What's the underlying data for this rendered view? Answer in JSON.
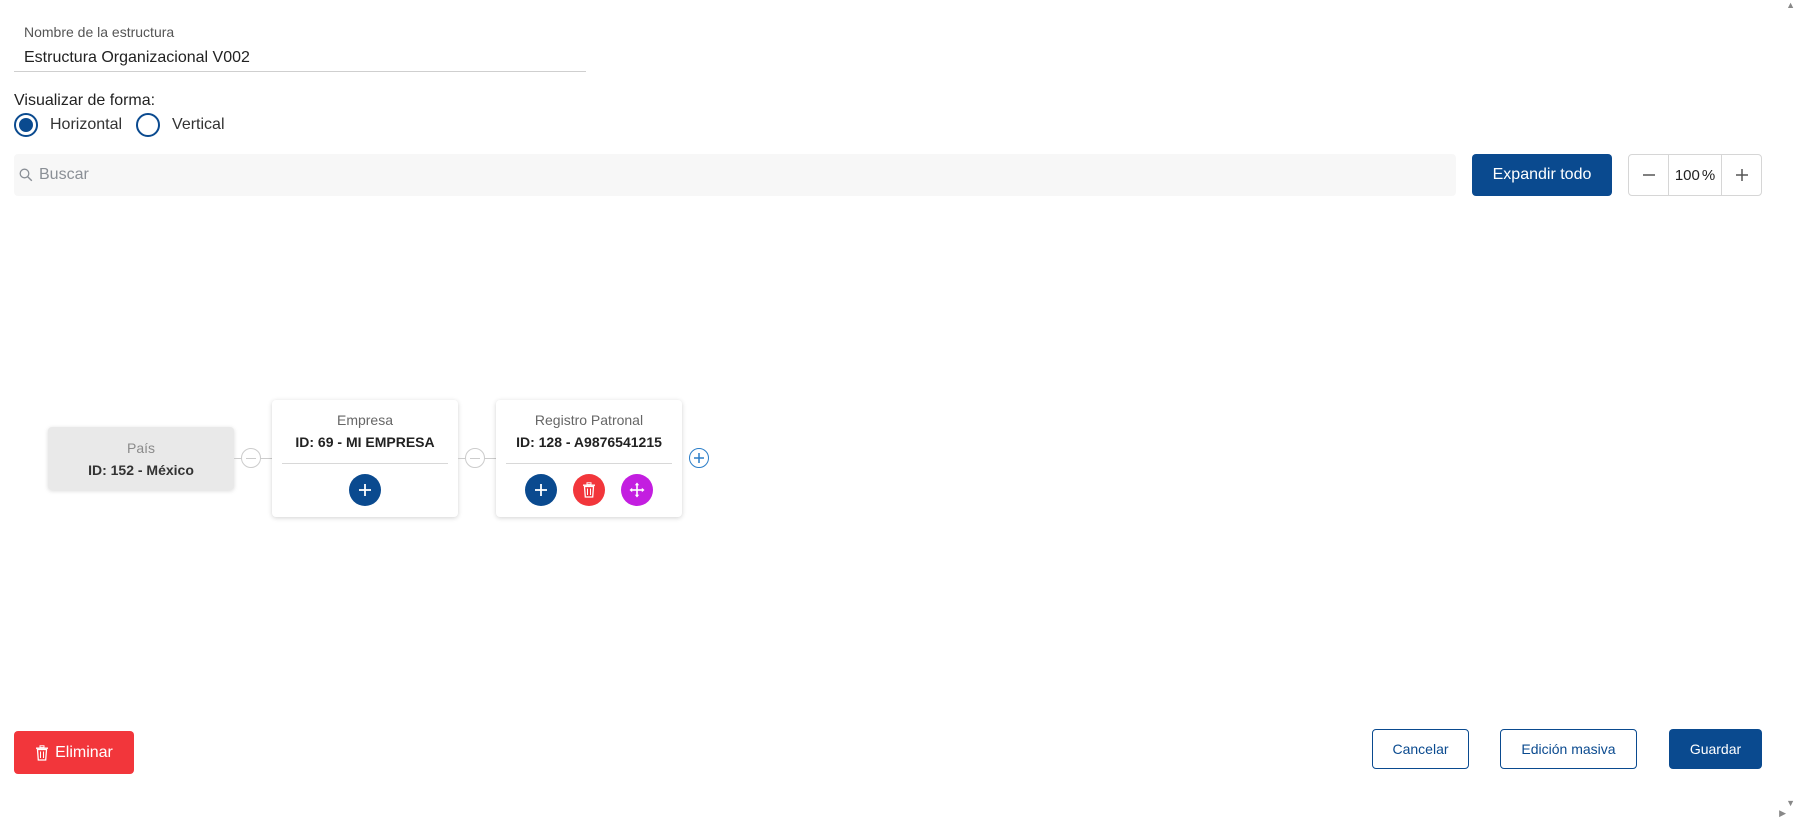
{
  "structure_name": {
    "label": "Nombre de la estructura",
    "value": "Estructura Organizacional V002"
  },
  "visualize": {
    "label": "Visualizar de forma:",
    "options": [
      {
        "label": "Horizontal",
        "selected": true
      },
      {
        "label": "Vertical",
        "selected": false
      }
    ]
  },
  "search": {
    "placeholder": "Buscar",
    "icon": "search-icon"
  },
  "toolbar": {
    "expand_label": "Expandir todo",
    "zoom_value": "100",
    "zoom_unit": "%",
    "zoom_out_icon": "minus-icon",
    "zoom_in_icon": "plus-icon"
  },
  "org_chart": {
    "nodes": [
      {
        "title": "País",
        "id_text": "ID: 152 - México"
      },
      {
        "title": "Empresa",
        "id_text": "ID: 69 - MI EMPRESA",
        "actions": [
          "add"
        ]
      },
      {
        "title": "Registro Patronal",
        "id_text": "ID: 128 - A9876541215",
        "actions": [
          "add",
          "delete",
          "move"
        ]
      }
    ]
  },
  "footer": {
    "delete_label": "Eliminar",
    "cancel_label": "Cancelar",
    "bulk_edit_label": "Edición masiva",
    "save_label": "Guardar"
  },
  "colors": {
    "primary": "#0a4a8f",
    "danger": "#f2363b",
    "move": "#c31ee0",
    "link": "#2a7dc8"
  }
}
